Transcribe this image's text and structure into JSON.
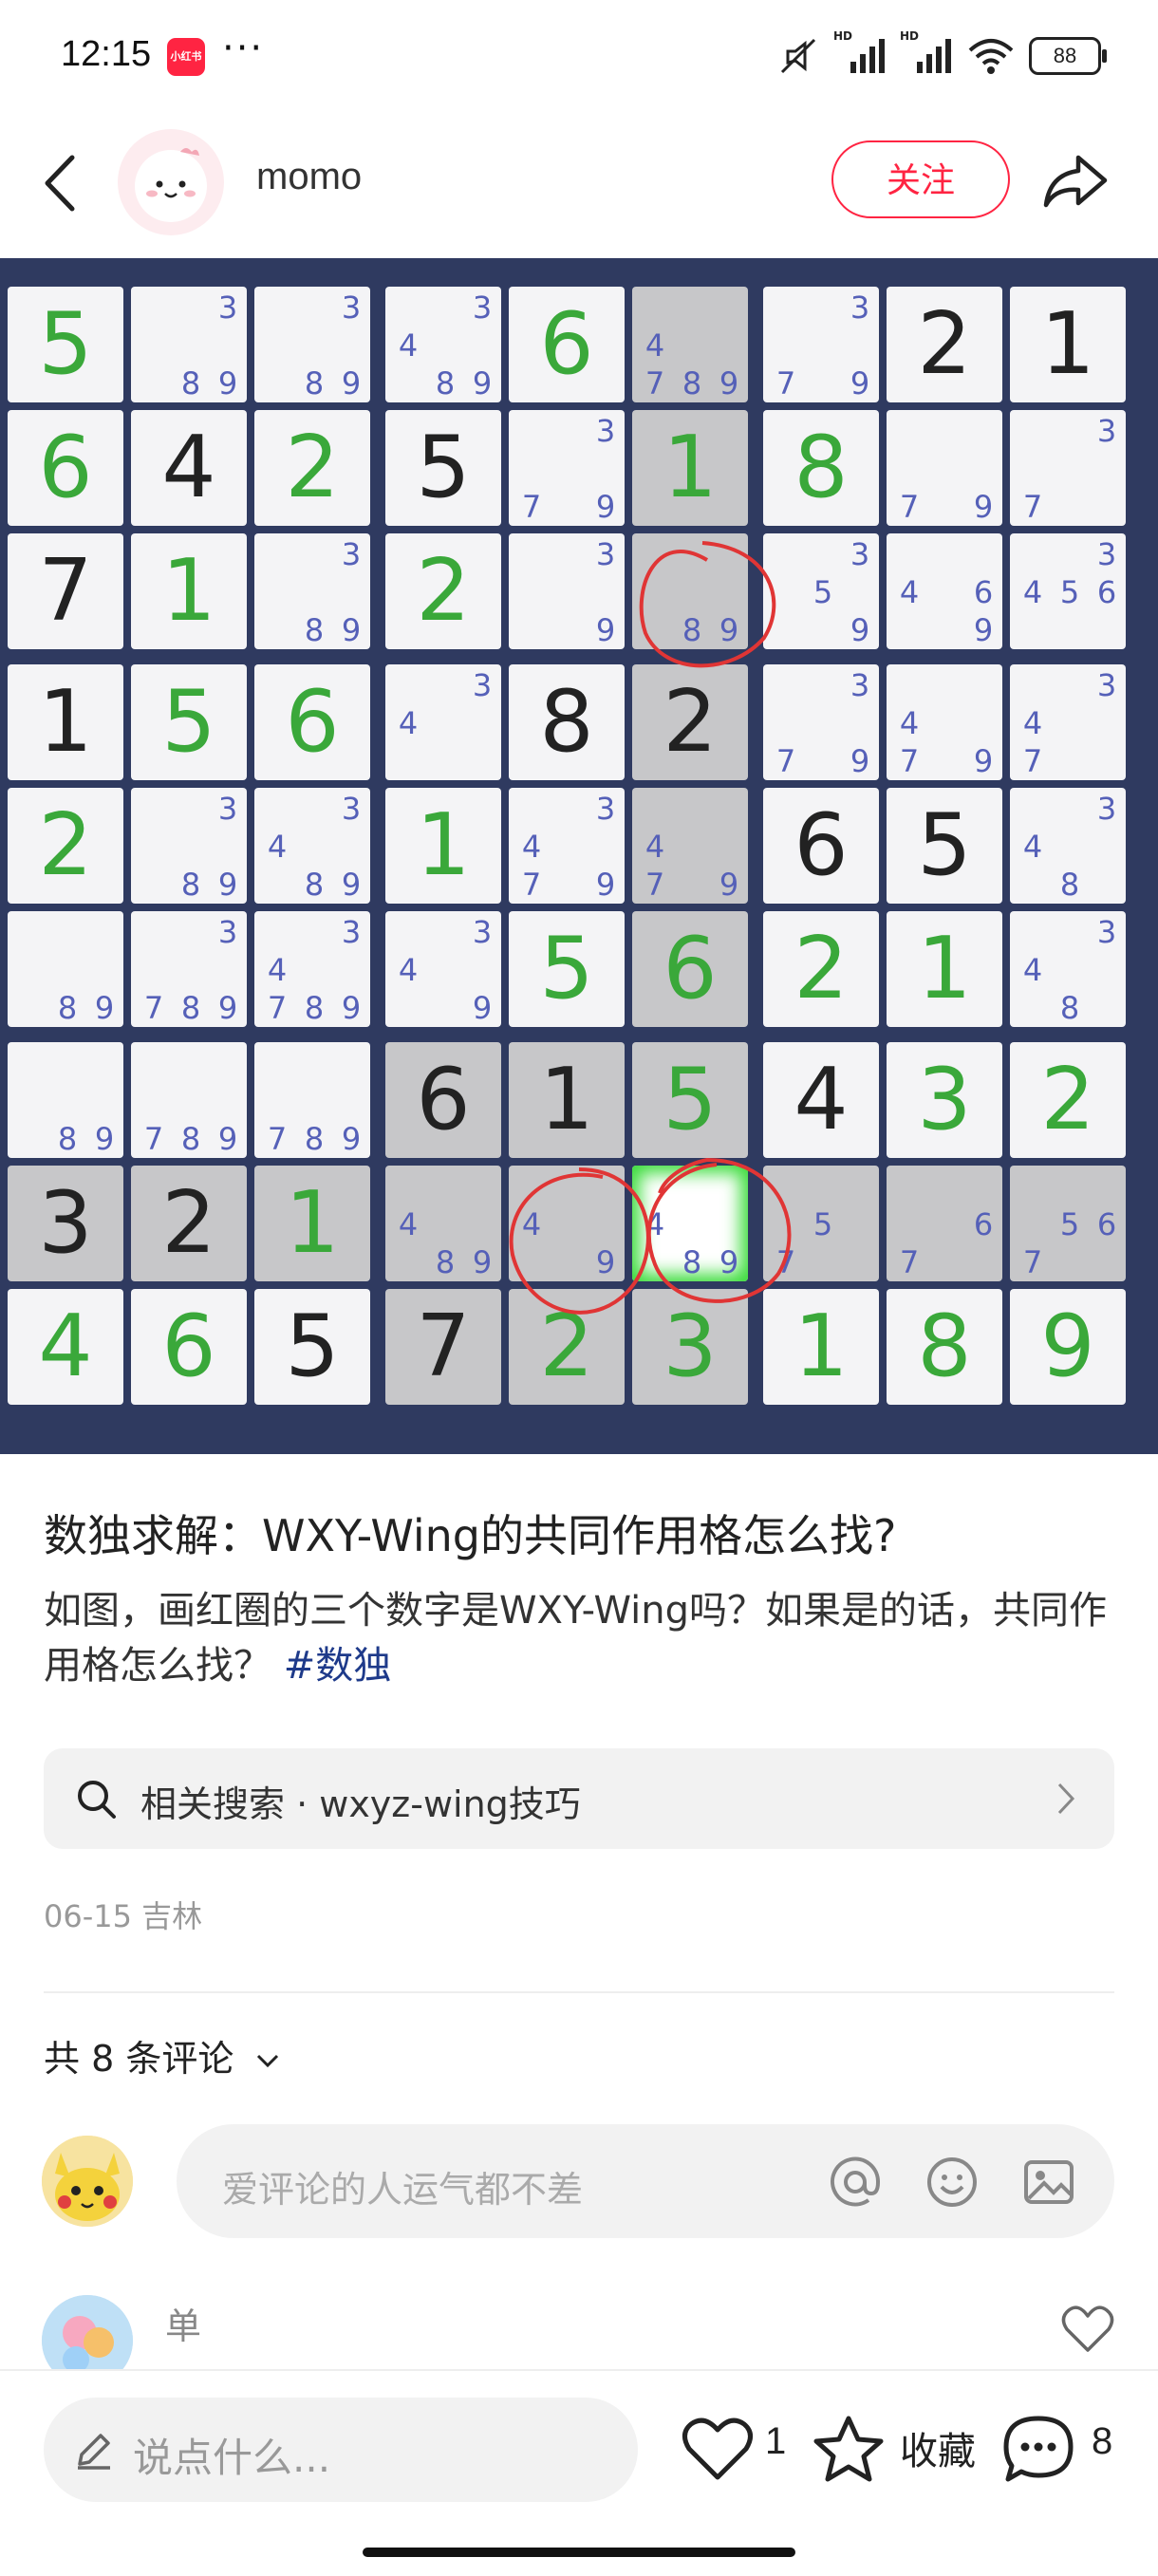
{
  "status_bar": {
    "time": "12:15",
    "app_badge": "小红书",
    "more": "···",
    "network_labels": [
      "HD",
      "HD"
    ],
    "battery": "88"
  },
  "header": {
    "author_name": "momo",
    "follow_label": "关注",
    "accent": "#ff2442"
  },
  "sudoku": {
    "rows": [
      [
        {
          "v": "5",
          "t": "s"
        },
        {
          "c": "389"
        },
        {
          "c": "389"
        },
        {
          "c": "3489"
        },
        {
          "v": "6",
          "t": "s"
        },
        {
          "c": "4789",
          "sh": true
        },
        {
          "c": "379"
        },
        {
          "v": "2",
          "t": "g"
        },
        {
          "v": "1",
          "t": "g"
        }
      ],
      [
        {
          "v": "6",
          "t": "s"
        },
        {
          "v": "4",
          "t": "g"
        },
        {
          "v": "2",
          "t": "s"
        },
        {
          "v": "5",
          "t": "g"
        },
        {
          "c": "379"
        },
        {
          "v": "1",
          "t": "s",
          "sh": true
        },
        {
          "v": "8",
          "t": "s"
        },
        {
          "c": "79"
        },
        {
          "c": "37"
        }
      ],
      [
        {
          "v": "7",
          "t": "g"
        },
        {
          "v": "1",
          "t": "s"
        },
        {
          "c": "389"
        },
        {
          "v": "2",
          "t": "s"
        },
        {
          "c": "39"
        },
        {
          "c": "89",
          "sh": true
        },
        {
          "c": "359"
        },
        {
          "c": "469"
        },
        {
          "c": "3456"
        }
      ],
      [
        {
          "v": "1",
          "t": "g"
        },
        {
          "v": "5",
          "t": "s"
        },
        {
          "v": "6",
          "t": "s"
        },
        {
          "c": "34"
        },
        {
          "v": "8",
          "t": "g"
        },
        {
          "v": "2",
          "t": "g",
          "sh": true
        },
        {
          "c": "379"
        },
        {
          "c": "479"
        },
        {
          "c": "347"
        }
      ],
      [
        {
          "v": "2",
          "t": "s"
        },
        {
          "c": "389"
        },
        {
          "c": "3489"
        },
        {
          "v": "1",
          "t": "s"
        },
        {
          "c": "3479"
        },
        {
          "c": "479",
          "sh": true
        },
        {
          "v": "6",
          "t": "g"
        },
        {
          "v": "5",
          "t": "g"
        },
        {
          "c": "348"
        }
      ],
      [
        {
          "c": "89"
        },
        {
          "c": "3789"
        },
        {
          "c": "34789"
        },
        {
          "c": "349"
        },
        {
          "v": "5",
          "t": "s"
        },
        {
          "v": "6",
          "t": "s",
          "sh": true
        },
        {
          "v": "2",
          "t": "s"
        },
        {
          "v": "1",
          "t": "s"
        },
        {
          "c": "348"
        }
      ],
      [
        {
          "c": "89"
        },
        {
          "c": "789"
        },
        {
          "c": "789"
        },
        {
          "v": "6",
          "t": "g",
          "sh": true
        },
        {
          "v": "1",
          "t": "g",
          "sh": true
        },
        {
          "v": "5",
          "t": "s",
          "sh": true
        },
        {
          "v": "4",
          "t": "g"
        },
        {
          "v": "3",
          "t": "s"
        },
        {
          "v": "2",
          "t": "s"
        }
      ],
      [
        {
          "v": "3",
          "t": "g",
          "sh": true
        },
        {
          "v": "2",
          "t": "g",
          "sh": true
        },
        {
          "v": "1",
          "t": "s",
          "sh": true
        },
        {
          "c": "489",
          "sh": true
        },
        {
          "c": "49",
          "sh": true
        },
        {
          "c": "489",
          "hl": true
        },
        {
          "c": "57",
          "sh": true
        },
        {
          "c": "67",
          "sh": true
        },
        {
          "c": "567",
          "sh": true
        }
      ],
      [
        {
          "v": "4",
          "t": "s"
        },
        {
          "v": "6",
          "t": "s"
        },
        {
          "v": "5",
          "t": "g"
        },
        {
          "v": "7",
          "t": "g",
          "sh": true
        },
        {
          "v": "2",
          "t": "s",
          "sh": true
        },
        {
          "v": "3",
          "t": "s",
          "sh": true
        },
        {
          "v": "1",
          "t": "s"
        },
        {
          "v": "8",
          "t": "s"
        },
        {
          "v": "9",
          "t": "s"
        }
      ]
    ],
    "colors": {
      "given": "#222222",
      "solved": "#3aa83a",
      "candidate": "#5560b8",
      "board": "#2f3a60",
      "circle": "#e03535"
    }
  },
  "post": {
    "title": "数独求解：WXY-Wing的共同作用格怎么找?",
    "body": "如图，画红圈的三个数字是WXY-Wing吗？如果是的话，共同作用格怎么找？",
    "hashtag": "#数独",
    "related_search": "相关搜索 · wxyz-wing技巧",
    "date": "06-15",
    "location": "吉林"
  },
  "comments": {
    "count_label": "共 8 条评论",
    "input_placeholder": "爱评论的人运气都不差",
    "first_commenter": "单"
  },
  "bottom_bar": {
    "say_placeholder": "说点什么...",
    "likes": "1",
    "collect_label": "收藏",
    "comments": "8"
  }
}
